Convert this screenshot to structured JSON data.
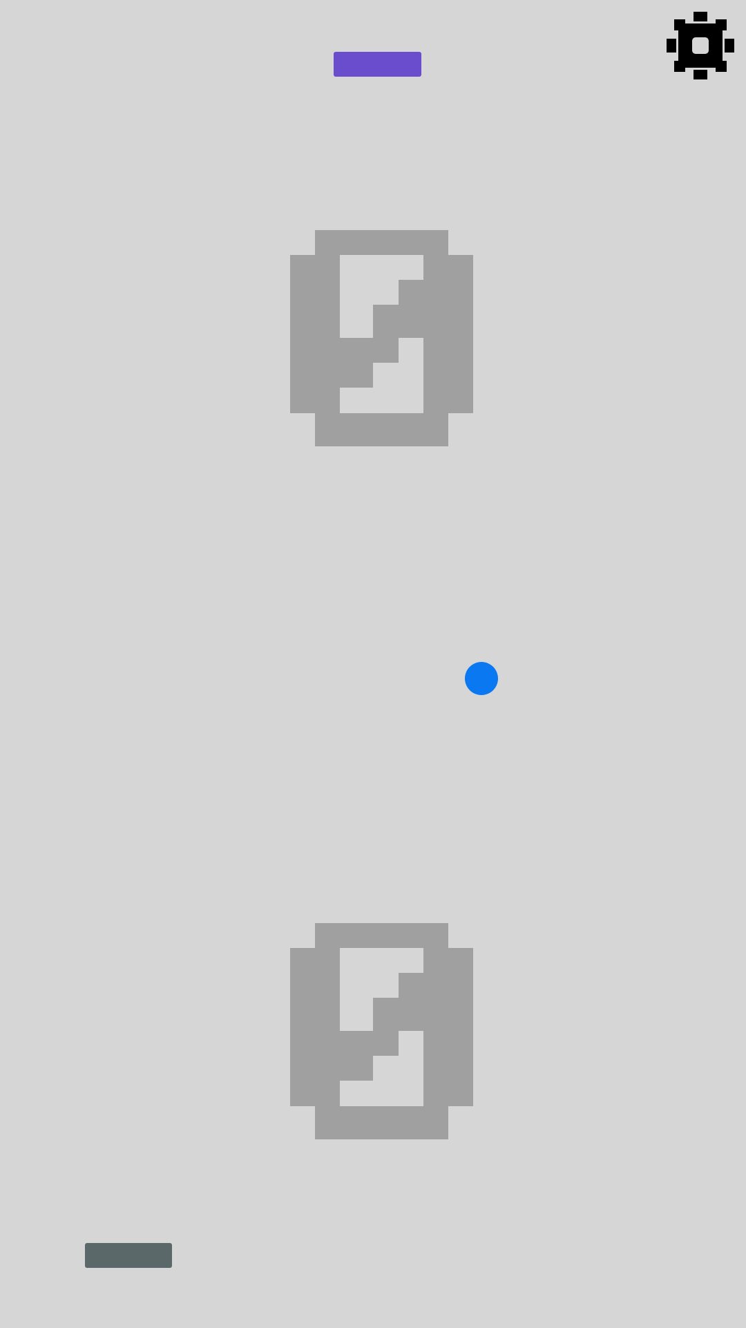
{
  "game": {
    "background_color": "#d6d6d6",
    "top_score": "2",
    "bottom_score": "2",
    "score_color": "#a0a0a0"
  },
  "top_paddle": {
    "color": "#6a4dcc"
  },
  "bottom_paddle": {
    "color": "#5a6869"
  },
  "ball": {
    "color": "#0a78f0"
  },
  "settings": {
    "icon": "gear-icon",
    "color": "#000000"
  }
}
